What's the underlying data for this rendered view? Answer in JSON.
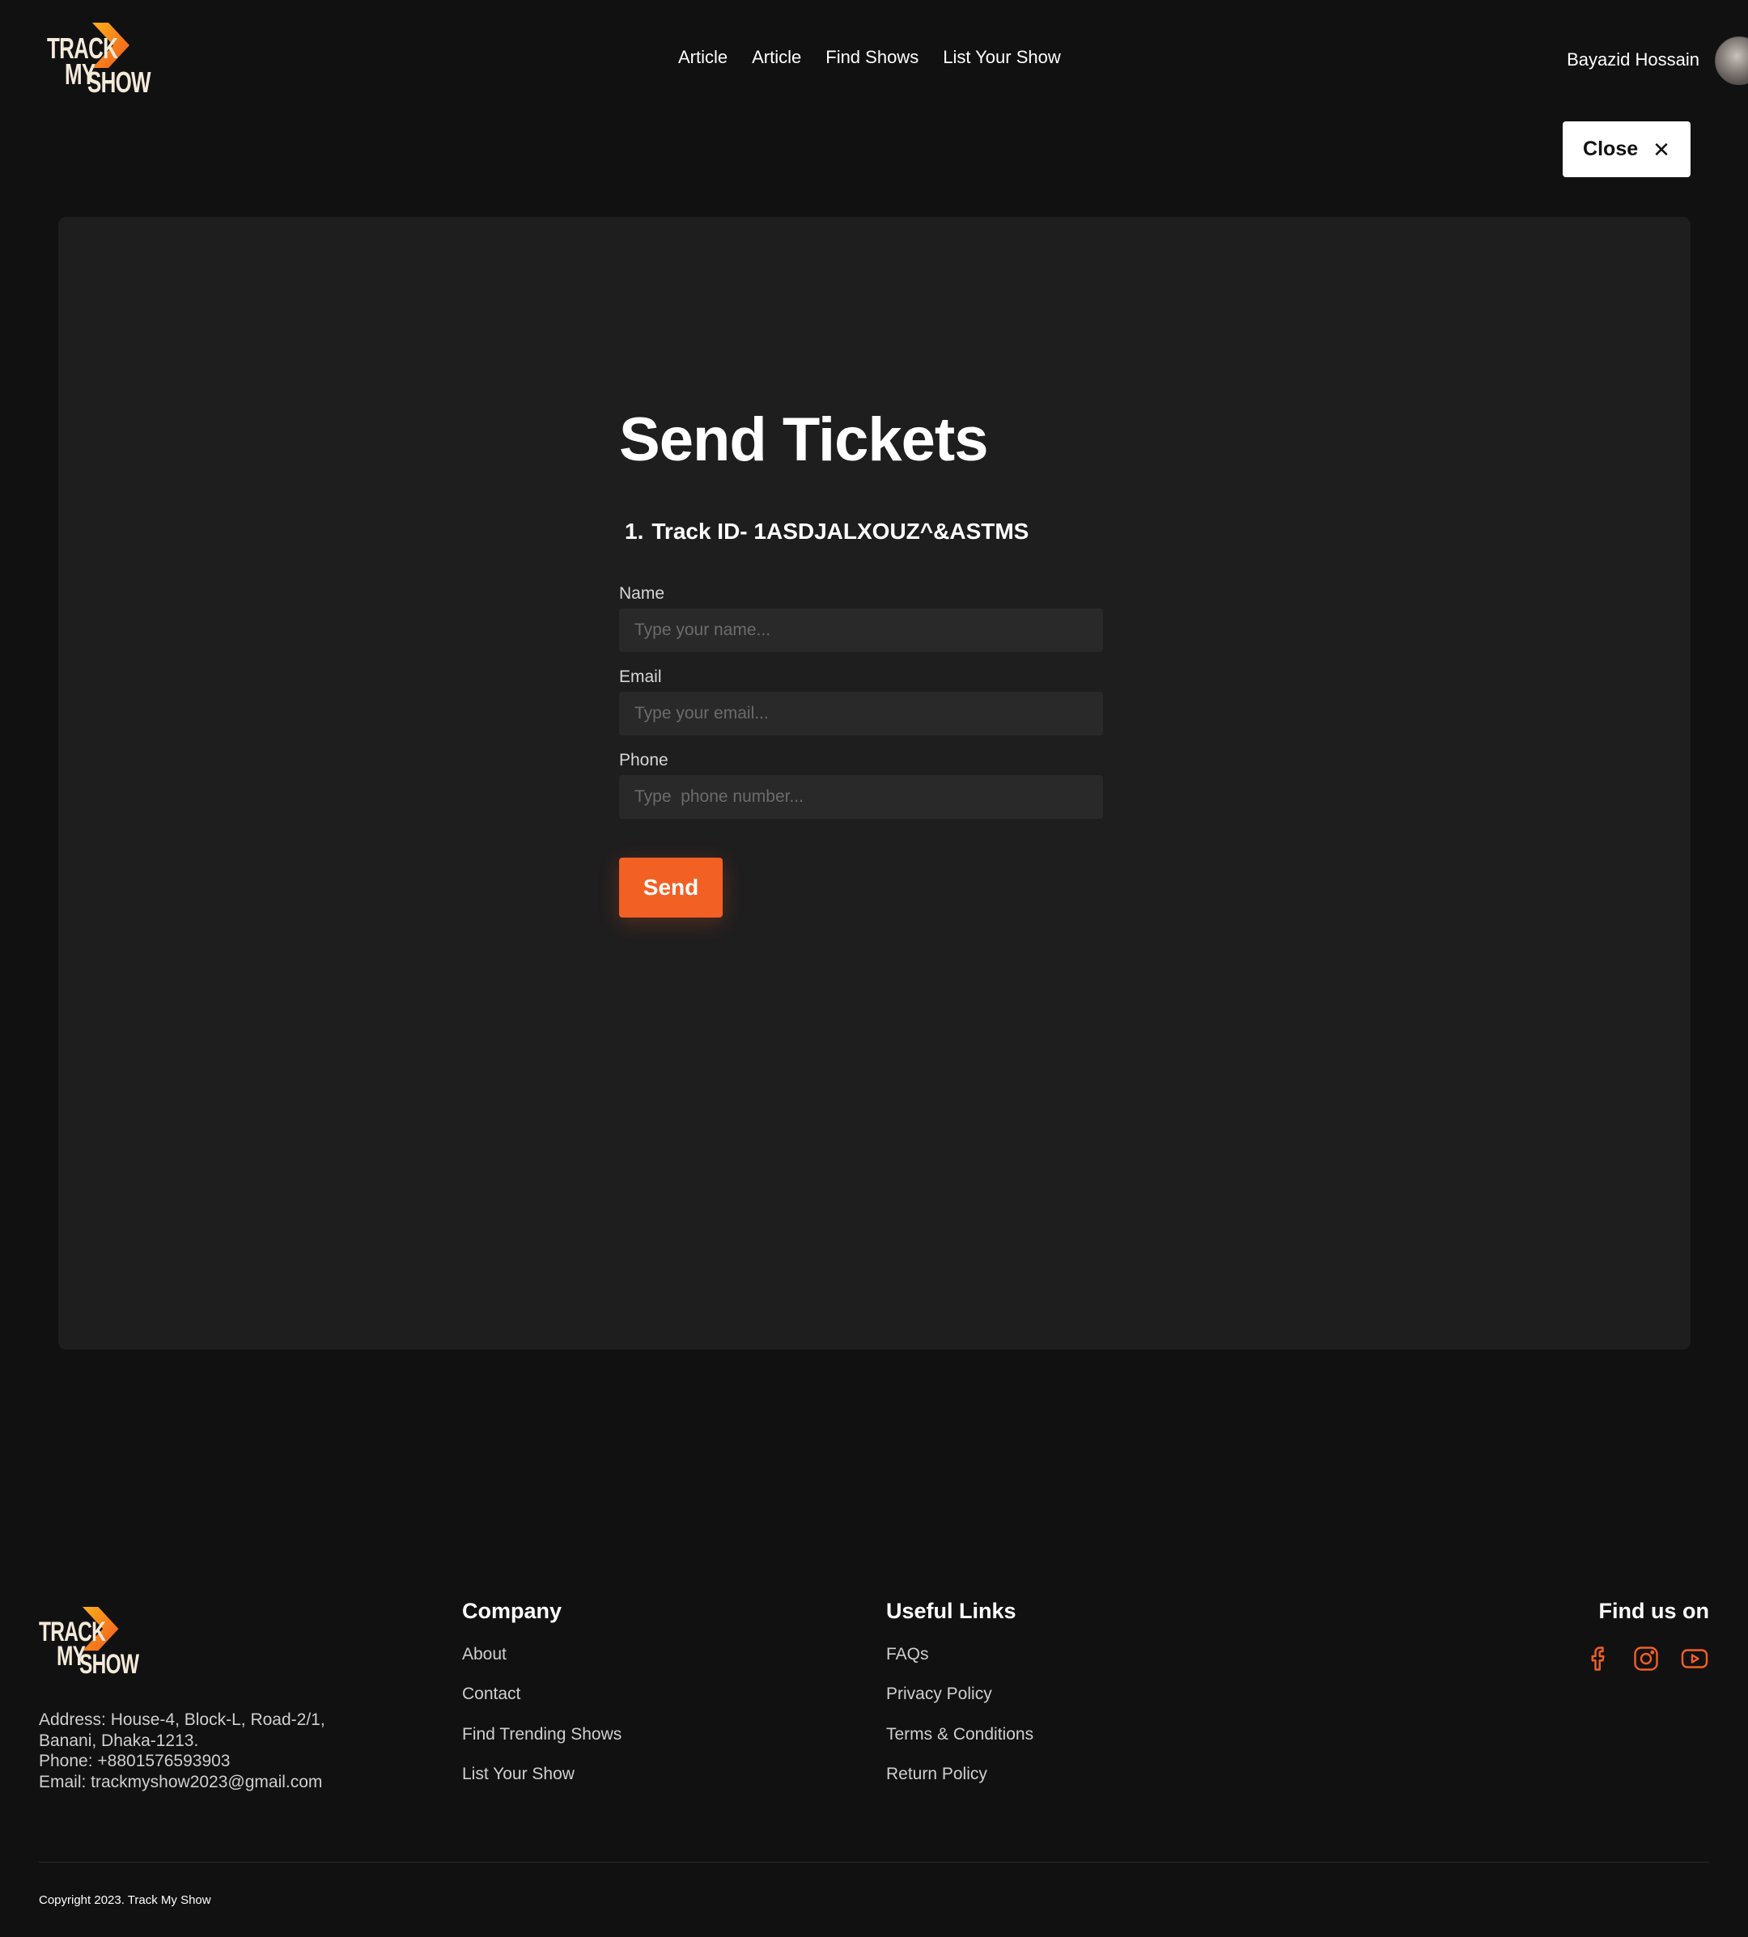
{
  "header": {
    "logo": {
      "line1": "TRACK",
      "line2": "MY",
      "line3": "SHOW"
    },
    "nav": [
      "Article",
      "Article",
      "Find Shows",
      "List Your Show"
    ],
    "user_name": "Bayazid Hossain",
    "close_label": "Close"
  },
  "form": {
    "title": "Send Tickets",
    "track_number": "1.",
    "track_id": "Track ID- 1ASDJALXOUZ^&ASTMS",
    "fields": [
      {
        "label": "Name",
        "placeholder": "Type your name..."
      },
      {
        "label": "Email",
        "placeholder": "Type your email..."
      },
      {
        "label": "Phone",
        "placeholder": "Type  phone number..."
      }
    ],
    "submit_label": "Send"
  },
  "footer": {
    "logo": {
      "line1": "TRACK",
      "line2": "MY",
      "line3": "SHOW"
    },
    "address": {
      "line1": "Address: House-4, Block-L, Road-2/1,",
      "line2": "Banani, Dhaka-1213.",
      "line3": "Phone:  +8801576593903",
      "line4": "Email:  trackmyshow2023@gmail.com"
    },
    "company": {
      "title": "Company",
      "links": [
        "About",
        "Contact",
        "Find Trending Shows",
        "List Your Show"
      ]
    },
    "useful_links": {
      "title": "Useful Links",
      "links": [
        "FAQs",
        "Privacy Policy",
        "Terms & Conditions",
        "Return Policy"
      ]
    },
    "social": {
      "title": "Find us on",
      "icons": [
        "facebook-icon",
        "instagram-icon",
        "youtube-icon"
      ]
    },
    "copyright": "Copyright 2023. Track My Show"
  },
  "colors": {
    "background": "#121112",
    "panel": "#1f1e1f",
    "input": "#2a292a",
    "accent": "#f26024",
    "logo_gradient_start": "#fbb01a",
    "logo_gradient_end": "#f2561f"
  }
}
